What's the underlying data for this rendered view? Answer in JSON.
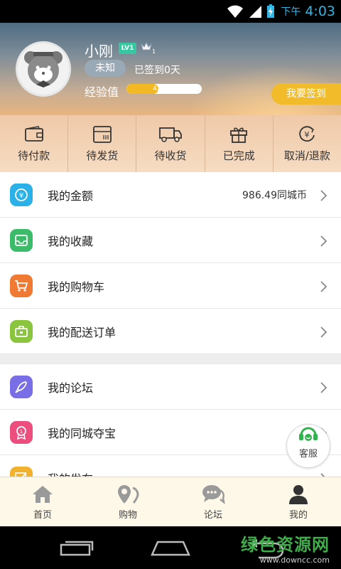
{
  "status": {
    "ampm": "下午",
    "time": "4:03"
  },
  "profile": {
    "username": "小刚",
    "level": "LV1",
    "crown_count": "1",
    "member_status": "未知",
    "signed_days": "已签到0天",
    "exp_label": "经验值",
    "exp_text": "42/100",
    "exp_progress": 0.42,
    "checkin_button": "我要签到"
  },
  "orders": [
    {
      "label": "待付款",
      "icon": "wallet-icon"
    },
    {
      "label": "待发货",
      "icon": "package-icon"
    },
    {
      "label": "待收货",
      "icon": "truck-icon"
    },
    {
      "label": "已完成",
      "icon": "gift-icon"
    },
    {
      "label": "取消/退款",
      "icon": "refund-icon"
    }
  ],
  "menu_group1": [
    {
      "label": "我的金额",
      "value": "986.49同城币",
      "icon": "coin-icon",
      "color": "#2bb0e7"
    },
    {
      "label": "我的收藏",
      "value": "",
      "icon": "inbox-icon",
      "color": "#3cbc6a"
    },
    {
      "label": "我的购物车",
      "value": "",
      "icon": "cart-icon",
      "color": "#f07a34"
    },
    {
      "label": "我的配送订单",
      "value": "",
      "icon": "briefcase-icon",
      "color": "#8bc43f"
    }
  ],
  "menu_group2": [
    {
      "label": "我的论坛",
      "icon": "rocket-icon",
      "color": "#7a6ee6"
    },
    {
      "label": "我的同城夺宝",
      "icon": "medal-icon",
      "color": "#ec4e7e"
    },
    {
      "label": "我的发布",
      "icon": "edit-icon",
      "color": "#f2b230"
    }
  ],
  "service_label": "客服",
  "tabs": [
    {
      "label": "首页",
      "icon": "home-icon"
    },
    {
      "label": "购物",
      "icon": "shopping-icon"
    },
    {
      "label": "论坛",
      "icon": "chat-icon"
    },
    {
      "label": "我的",
      "icon": "user-icon"
    }
  ],
  "watermark": {
    "title": "绿色资源网",
    "url": "www.downcc.com"
  }
}
